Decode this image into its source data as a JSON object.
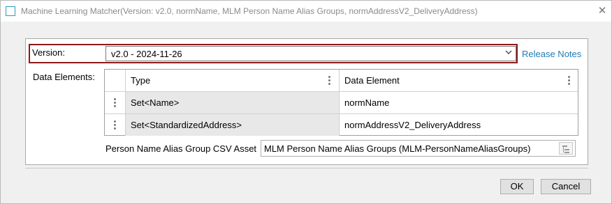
{
  "window": {
    "title": "Machine Learning Matcher(Version: v2.0, normName, MLM Person Name Alias Groups, normAddressV2_DeliveryAddress)",
    "close_glyph": "✕"
  },
  "version": {
    "label": "Version:",
    "selected": "v2.0 - 2024-11-26",
    "release_notes_link": "Release Notes"
  },
  "data_elements": {
    "label": "Data Elements:",
    "columns": [
      "Type",
      "Data Element"
    ],
    "rows": [
      {
        "type": "Set<Name>",
        "element": "normName"
      },
      {
        "type": "Set<StandardizedAddress>",
        "element": "normAddressV2_DeliveryAddress"
      }
    ]
  },
  "csv_asset": {
    "label": "Person Name Alias Group CSV Asset",
    "value": "MLM Person Name Alias Groups (MLM-PersonNameAliasGroups)"
  },
  "buttons": {
    "ok": "OK",
    "cancel": "Cancel"
  },
  "colors": {
    "highlight_border": "#8b1a1a",
    "link": "#1f7bb6",
    "icon_accent": "#2a9fc0"
  },
  "icons": {
    "app": "window-icon",
    "dropdown": "chevron-down-icon",
    "row_handle": "drag-handle-icon",
    "column_menu": "vertical-dots-icon",
    "asset_picker": "tree-browse-icon"
  }
}
